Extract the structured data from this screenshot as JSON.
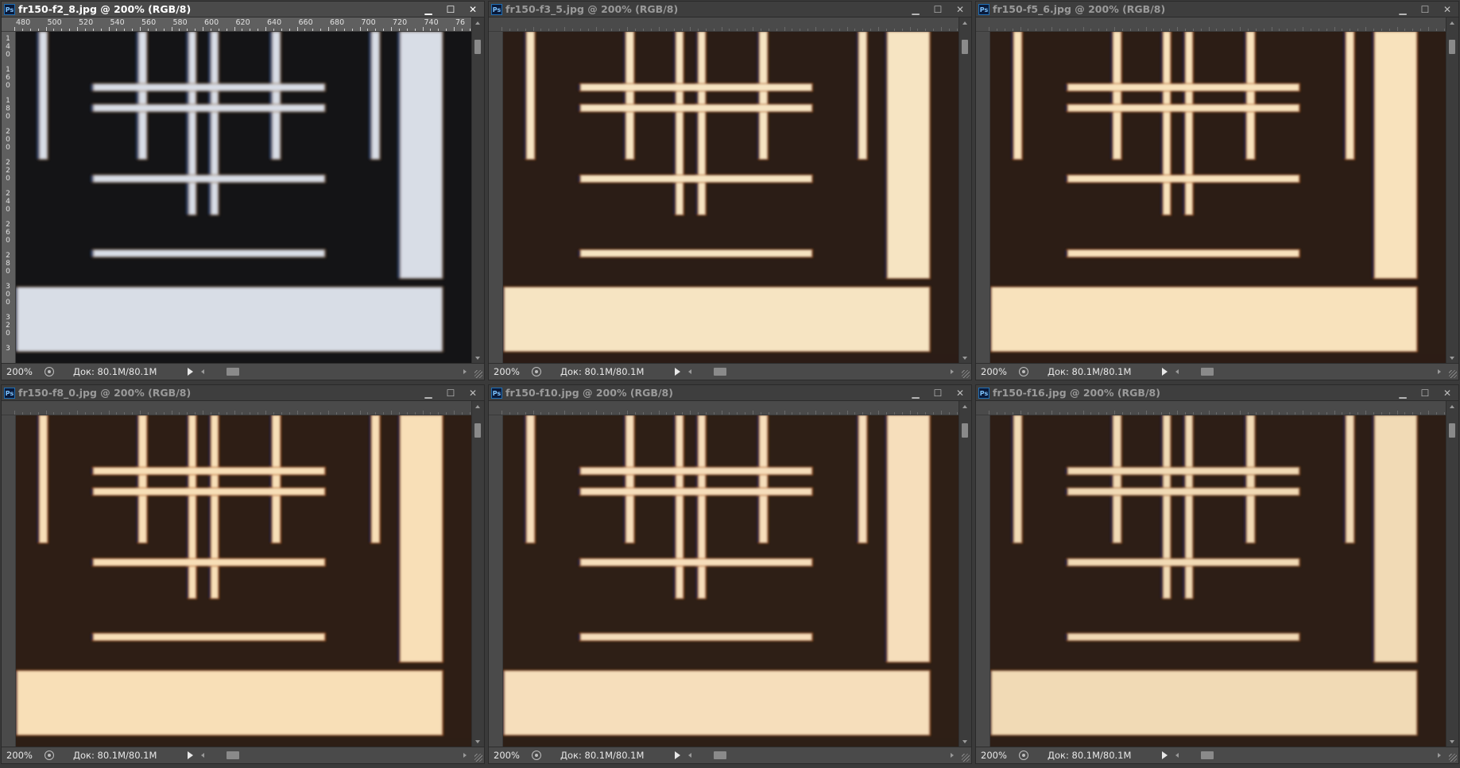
{
  "documents": [
    {
      "title": "fr150-f2_8.jpg @ 200% (RGB/8)",
      "active": true,
      "zoom": "200%",
      "doc_info": "Док: 80.1M/80.1M",
      "ruler_labels": [
        "480",
        "500",
        "520",
        "540",
        "560",
        "580",
        "600",
        "620",
        "640",
        "660",
        "680",
        "700",
        "720",
        "740",
        "76"
      ],
      "vertical_ruler_labels": [
        "1 4 0",
        "1 6 0",
        "1 8 0",
        "2 0 0",
        "2 2 0",
        "2 4 0",
        "2 6 0",
        "2 8 0",
        "3 0 0",
        "3 2 0",
        "3"
      ],
      "palette": {
        "bg": "#141416",
        "line": "#d8dde6",
        "glowA": "#3a5f9e",
        "glowB": "#8f6a3a",
        "block": "#dde2ea"
      }
    },
    {
      "title": "fr150-f3_5.jpg @ 200% (RGB/8)",
      "active": false,
      "zoom": "200%",
      "doc_info": "Док: 80.1M/80.1M",
      "ruler_labels": [],
      "vertical_ruler_labels": [],
      "palette": {
        "bg": "#2b1d16",
        "line": "#f6e4c2",
        "glowA": "#1e2a5a",
        "glowB": "#b3641b",
        "block": "#f9e6c6"
      }
    },
    {
      "title": "fr150-f5_6.jpg @ 200% (RGB/8)",
      "active": false,
      "zoom": "200%",
      "doc_info": "Док: 80.1M/80.1M",
      "ruler_labels": [],
      "vertical_ruler_labels": [],
      "palette": {
        "bg": "#2c1d15",
        "line": "#f8e2bc",
        "glowA": "#1d2858",
        "glowB": "#b8641a",
        "block": "#fae4c0"
      }
    },
    {
      "title": "fr150-f8_0.jpg @ 200% (RGB/8)",
      "active": false,
      "zoom": "200%",
      "doc_info": "Док: 80.1M/80.1M",
      "ruler_labels": [],
      "vertical_ruler_labels": [],
      "palette": {
        "bg": "#2e1e15",
        "line": "#f8dfb7",
        "glowA": "#1d2756",
        "glowB": "#bb651a",
        "block": "#f9e1ba"
      }
    },
    {
      "title": "fr150-f10.jpg @ 200% (RGB/8)",
      "active": false,
      "zoom": "200%",
      "doc_info": "Док: 80.1M/80.1M",
      "ruler_labels": [],
      "vertical_ruler_labels": [],
      "palette": {
        "bg": "#2e1f16",
        "line": "#f6debb",
        "glowA": "#1e2757",
        "glowB": "#ba651b",
        "block": "#f8e0bd"
      }
    },
    {
      "title": "fr150-f16.jpg @ 200% (RGB/8)",
      "active": false,
      "zoom": "200%",
      "doc_info": "Док: 80.1M/80.1M",
      "ruler_labels": [],
      "vertical_ruler_labels": [],
      "palette": {
        "bg": "#2d1e16",
        "line": "#f1dab5",
        "glowA": "#1f2858",
        "glowB": "#a8601e",
        "block": "#f3dcb8"
      }
    }
  ],
  "icons": {
    "app": "photoshop-icon",
    "minimize": "minimize-icon",
    "maximize": "maximize-icon",
    "close": "close-icon",
    "status": "status-menu-icon",
    "play": "play-icon"
  },
  "labels": {
    "ps_icon": "Ps",
    "minimize": "▁",
    "maximize": "☐",
    "close": "✕"
  }
}
